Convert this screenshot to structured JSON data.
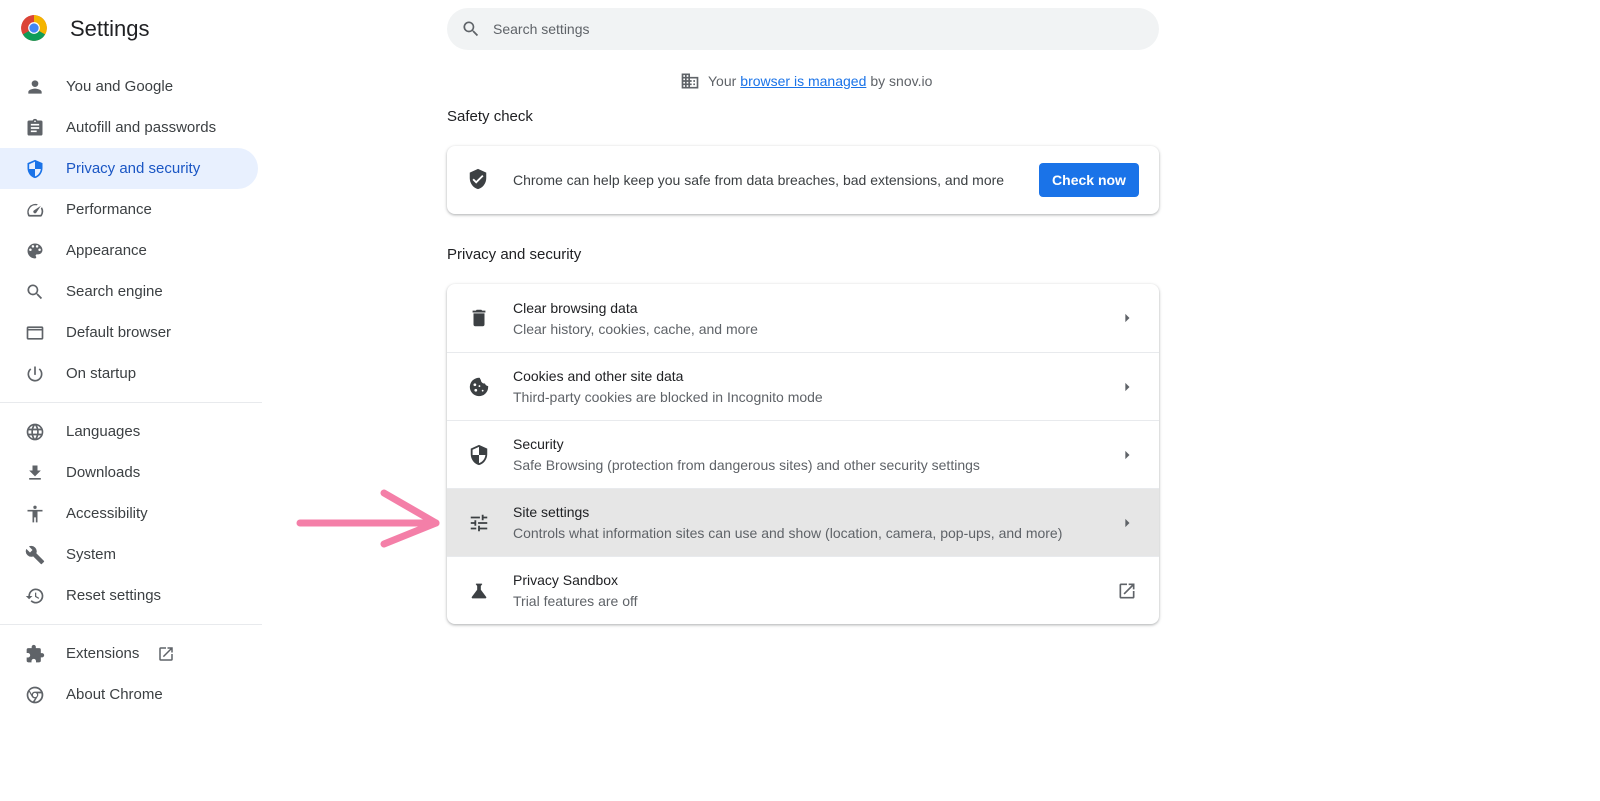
{
  "app": {
    "title": "Settings"
  },
  "search": {
    "placeholder": "Search settings"
  },
  "managed": {
    "prefix": "Your",
    "link": "browser is managed",
    "suffix": "by snov.io"
  },
  "sidebar": {
    "group1": [
      {
        "label": "You and Google",
        "icon": "person-icon"
      },
      {
        "label": "Autofill and passwords",
        "icon": "clipboard-icon"
      },
      {
        "label": "Privacy and security",
        "icon": "shield-icon",
        "active": true
      },
      {
        "label": "Performance",
        "icon": "speedometer-icon"
      },
      {
        "label": "Appearance",
        "icon": "palette-icon"
      },
      {
        "label": "Search engine",
        "icon": "search-icon"
      },
      {
        "label": "Default browser",
        "icon": "browser-window-icon"
      },
      {
        "label": "On startup",
        "icon": "power-icon"
      }
    ],
    "group2": [
      {
        "label": "Languages",
        "icon": "globe-icon"
      },
      {
        "label": "Downloads",
        "icon": "download-icon"
      },
      {
        "label": "Accessibility",
        "icon": "accessibility-icon"
      },
      {
        "label": "System",
        "icon": "wrench-icon"
      },
      {
        "label": "Reset settings",
        "icon": "history-icon"
      }
    ],
    "group3": [
      {
        "label": "Extensions",
        "icon": "puzzle-icon",
        "external": true
      },
      {
        "label": "About Chrome",
        "icon": "chrome-icon"
      }
    ]
  },
  "safety": {
    "title": "Safety check",
    "text": "Chrome can help keep you safe from data breaches, bad extensions, and more",
    "button": "Check now"
  },
  "privacy": {
    "title": "Privacy and security",
    "rows": [
      {
        "title": "Clear browsing data",
        "sub": "Clear history, cookies, cache, and more",
        "icon": "trash-icon"
      },
      {
        "title": "Cookies and other site data",
        "sub": "Third-party cookies are blocked in Incognito mode",
        "icon": "cookie-icon"
      },
      {
        "title": "Security",
        "sub": "Safe Browsing (protection from dangerous sites) and other security settings",
        "icon": "shield-outline-icon"
      },
      {
        "title": "Site settings",
        "sub": "Controls what information sites can use and show (location, camera, pop-ups, and more)",
        "icon": "sliders-icon",
        "highlight": true
      },
      {
        "title": "Privacy Sandbox",
        "sub": "Trial features are off",
        "icon": "flask-icon",
        "external": true
      }
    ]
  },
  "colors": {
    "accent": "#1a73e8",
    "active_bg": "#e8f0fe",
    "highlight_row": "#e6e6e6",
    "annotation_arrow": "#f47fa8"
  }
}
